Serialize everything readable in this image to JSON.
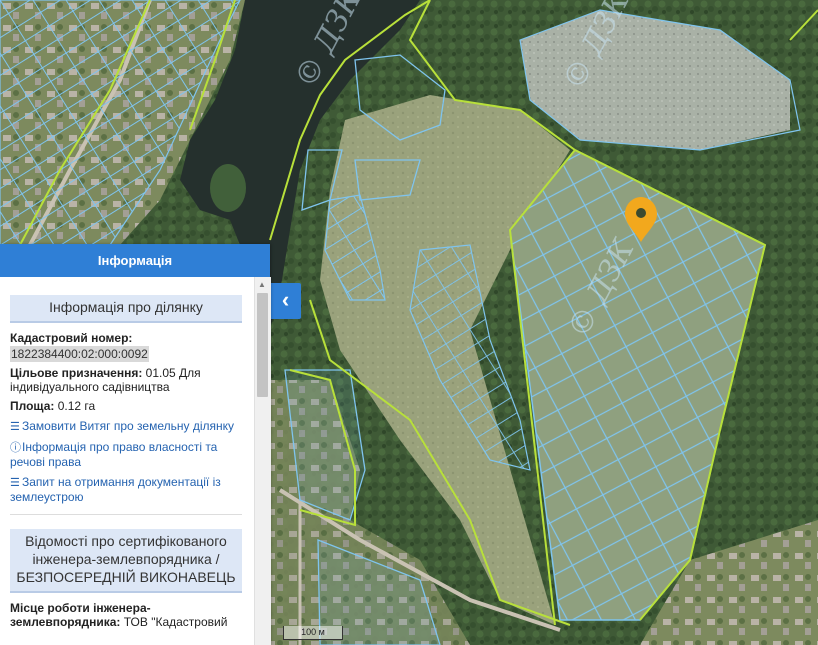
{
  "map": {
    "watermark": "© ДЗК",
    "scale_label": "100 м",
    "colors": {
      "boundary_green": "#b8e03a",
      "parcel_blue": "#7fc4ee",
      "marker_orange": "#f2a81d"
    }
  },
  "panel": {
    "header": "Інформація",
    "section_title": "Інформація про ділянку",
    "cadastral_label": "Кадастровий номер:",
    "cadastral_value": "1822384400:02:000:0092",
    "purpose_label": "Цільове призначення:",
    "purpose_value": " 01.05 Для індивідуального садівництва",
    "area_label": "Площа:",
    "area_value": " 0.12 га",
    "links": [
      {
        "icon": "document-list-icon",
        "label": "Замовити Витяг про земельну ділянку"
      },
      {
        "icon": "info-circle-icon",
        "label": "Інформація про право власності та речові права"
      },
      {
        "icon": "document-list-icon",
        "label": "Запит на отримання документації із землеустрою"
      }
    ],
    "engineer_section_title": "Відомості про сертифікованого інженера-землевпорядника / БЕЗПОСЕРЕДНІЙ ВИКОНАВЕЦЬ",
    "work_place_label": "Місце роботи інженера-землевпорядника:",
    "work_place_value": " ТОВ \"Кадастровий"
  },
  "collapse_button": "‹"
}
